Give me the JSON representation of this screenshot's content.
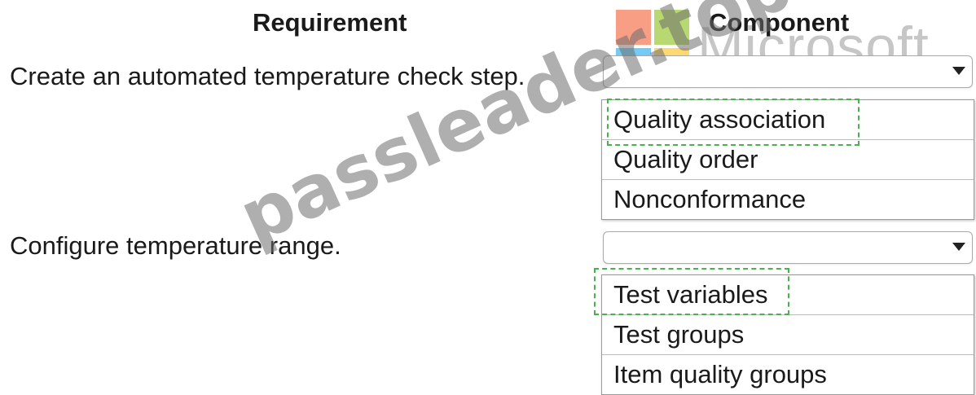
{
  "headers": {
    "requirement": "Requirement",
    "component": "Component"
  },
  "rows": [
    {
      "requirement": "Create an automated temperature check step.",
      "selected_value": "",
      "options": [
        "Quality association",
        "Quality order",
        "Nonconformance"
      ],
      "highlighted_option": "Quality association"
    },
    {
      "requirement": "Configure temperature range.",
      "selected_value": "",
      "options": [
        "Test variables",
        "Test groups",
        "Item quality groups"
      ],
      "highlighted_option": "Test variables"
    }
  ],
  "watermarks": {
    "brand_text": "Microsoft",
    "site_text": "passleader.top"
  },
  "colors": {
    "highlight_border": "#4caf50",
    "logo_red": "#f25022",
    "logo_green": "#7fba00",
    "logo_blue": "#00a4ef",
    "logo_yellow": "#ffb900"
  }
}
